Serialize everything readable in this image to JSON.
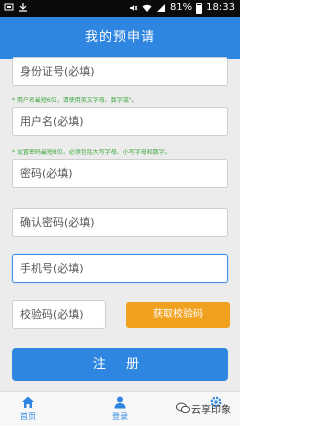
{
  "status_bar": {
    "battery": "81%",
    "time": "18:33"
  },
  "header": {
    "title": "我的预申请"
  },
  "form": {
    "id_card_placeholder": "身份证号(必填)",
    "username_hint": "* 用户名最短6位，请使用英文字母、数字或\"。",
    "username_placeholder": "用户名(必填)",
    "password_hint": "* 设置密码最短8位，必须包括大写字母、小写字母和数字。",
    "password_placeholder": "密码(必填)",
    "confirm_password_placeholder": "确认密码(必填)",
    "phone_placeholder": "手机号(必填)",
    "verification_code_placeholder": "校验码(必填)",
    "get_code_button": "获取校验码",
    "register_button": "注 册"
  },
  "bottom_nav": {
    "items": [
      {
        "label": "首页",
        "icon": "home-icon"
      },
      {
        "label": "登录",
        "icon": "user-icon"
      },
      {
        "label": "",
        "icon": "gear-icon"
      }
    ]
  },
  "watermark": {
    "text": "云享印象"
  },
  "colors": {
    "primary": "#2f86e0",
    "accent": "#f0a21e",
    "hint": "#3da63d"
  }
}
